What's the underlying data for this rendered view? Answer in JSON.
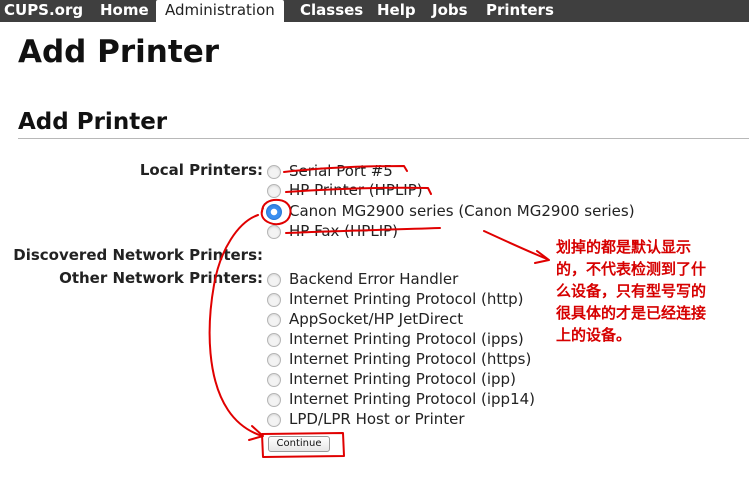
{
  "nav": {
    "items": [
      {
        "label": "CUPS.org"
      },
      {
        "label": "Home"
      },
      {
        "label": "Administration"
      },
      {
        "label": "Classes"
      },
      {
        "label": "Help"
      },
      {
        "label": "Jobs"
      },
      {
        "label": "Printers"
      }
    ],
    "active": "Administration"
  },
  "page": {
    "title": "Add Printer",
    "section_title": "Add Printer"
  },
  "form": {
    "local_label": "Local Printers:",
    "local_options": [
      {
        "label": "Serial Port #5",
        "checked": false
      },
      {
        "label": "HP Printer (HPLIP)",
        "checked": false
      },
      {
        "label": "Canon MG2900 series (Canon MG2900 series)",
        "checked": true
      },
      {
        "label": "HP Fax (HPLIP)",
        "checked": false
      }
    ],
    "discovered_label": "Discovered Network Printers:",
    "other_label": "Other Network Printers:",
    "other_options": [
      {
        "label": "Backend Error Handler",
        "checked": false
      },
      {
        "label": "Internet Printing Protocol (http)",
        "checked": false
      },
      {
        "label": "AppSocket/HP JetDirect",
        "checked": false
      },
      {
        "label": "Internet Printing Protocol (ipps)",
        "checked": false
      },
      {
        "label": "Internet Printing Protocol (https)",
        "checked": false
      },
      {
        "label": "Internet Printing Protocol (ipp)",
        "checked": false
      },
      {
        "label": "Internet Printing Protocol (ipp14)",
        "checked": false
      },
      {
        "label": "LPD/LPR Host or Printer",
        "checked": false
      }
    ],
    "continue_label": "Continue"
  },
  "annotation": {
    "text": "划掉的都是默认显示的，不代表检测到了什么设备，只有型号写的很具体的才是已经连接上的设备。",
    "color": "#d60000"
  },
  "colors": {
    "nav_bg": "#3f3f3f",
    "radio_accent": "#3a8ef0",
    "annotation_red": "#d60000"
  }
}
